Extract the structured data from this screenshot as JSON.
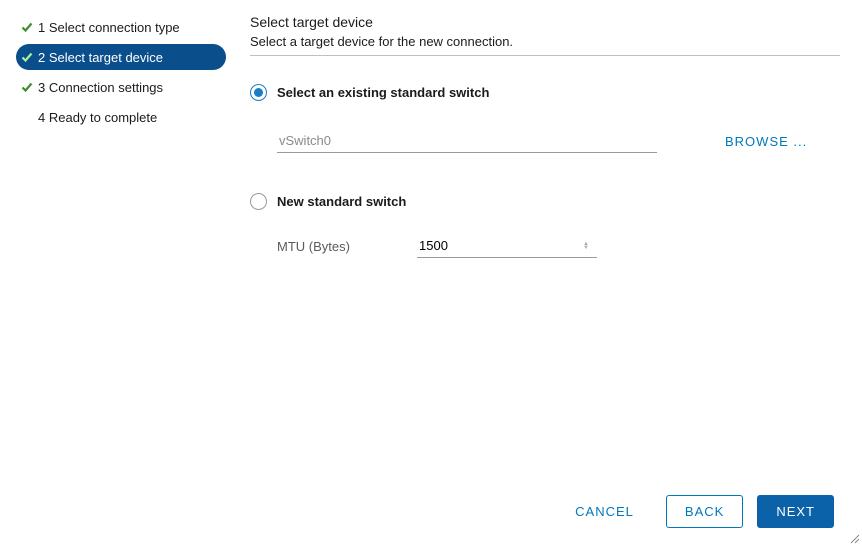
{
  "nav": {
    "items": [
      {
        "label": "1 Select connection type",
        "state": "done"
      },
      {
        "label": "2 Select target device",
        "state": "active"
      },
      {
        "label": "3 Connection settings",
        "state": "done"
      },
      {
        "label": "4 Ready to complete",
        "state": "pending"
      }
    ]
  },
  "main": {
    "title": "Select target device",
    "subtitle": "Select a target device for the new connection.",
    "radio_existing_label": "Select an existing standard switch",
    "radio_new_label": "New standard switch",
    "existing_switch_value": "vSwitch0",
    "browse_label": "BROWSE ...",
    "mtu_label": "MTU (Bytes)",
    "mtu_value": "1500"
  },
  "footer": {
    "cancel": "CANCEL",
    "back": "BACK",
    "next": "NEXT"
  }
}
